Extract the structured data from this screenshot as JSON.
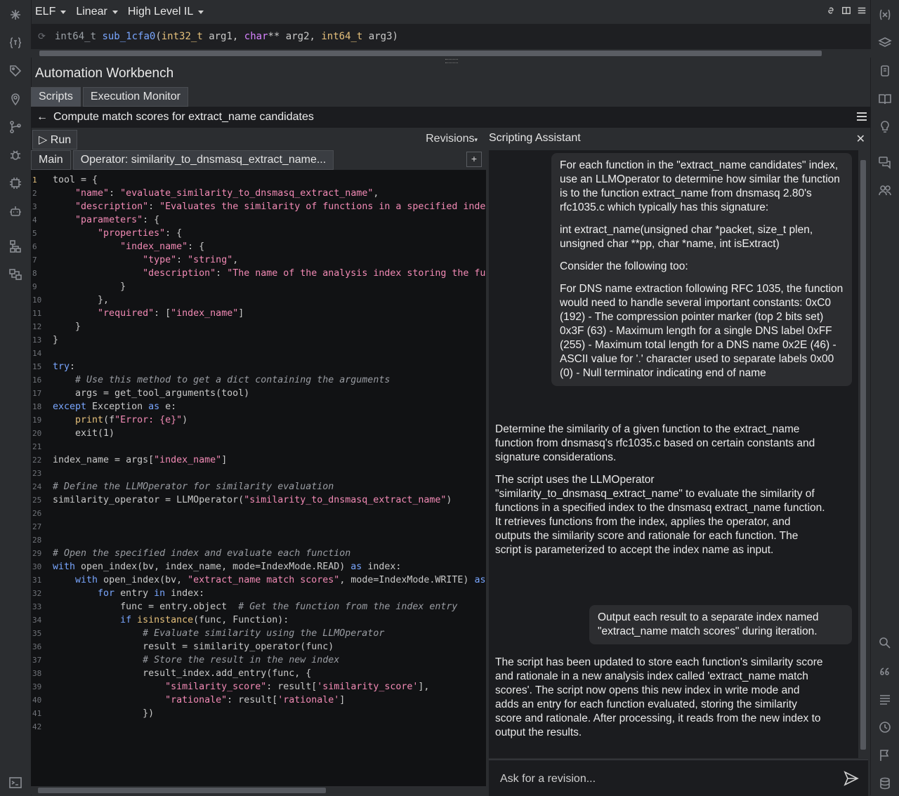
{
  "toolbar": {
    "view_type": "ELF",
    "layout": "Linear",
    "il_level": "High Level IL"
  },
  "signature": {
    "ret_type": "int64_t",
    "func_name": "sub_1cfa0",
    "open": "(",
    "p1_type": "int32_t",
    "p1_name": " arg1, ",
    "p2_type": "char",
    "p2_rest": "** arg2, ",
    "p3_type": "int64_t",
    "p3_name": " arg3",
    "close": ")"
  },
  "workbench": {
    "title": "Automation Workbench",
    "tabs": [
      "Scripts",
      "Execution Monitor"
    ],
    "breadcrumb": "Compute match scores for extract_name candidates",
    "run_label": "Run",
    "revisions_label": "Revisions",
    "subtabs": [
      "Main",
      "Operator: similarity_to_dnsmasq_extract_name..."
    ]
  },
  "assistant": {
    "title": "Scripting Assistant",
    "input_placeholder": "Ask for a revision...",
    "msg1": [
      "For each function in the \"extract_name candidates\" index, use an LLMOperator to determine how similar the function is to the function extract_name from dnsmasq 2.80's rfc1035.c which typically has this signature:",
      "int extract_name(unsigned char *packet, size_t plen, unsigned char **pp, char *name, int isExtract)",
      "Consider the following too:",
      "For DNS name extraction following RFC 1035, the function would need to handle several important constants: 0xC0 (192) - The compression pointer marker (top 2 bits set) 0x3F (63) - Maximum length for a single DNS label 0xFF (255) - Maximum total length for a DNS name 0x2E (46) - ASCII value for '.' character used to separate labels 0x00 (0) - Null terminator indicating end of name"
    ],
    "reply1": [
      "Determine the similarity of a given function to the extract_name function from dnsmasq's rfc1035.c based on certain constants and signature considerations.",
      "The script uses the LLMOperator \"similarity_to_dnsmasq_extract_name\" to evaluate the similarity of functions in a specified index to the dnsmasq extract_name function. It retrieves functions from the index, applies the operator, and outputs the similarity score and rationale for each function. The script is parameterized to accept the index name as input."
    ],
    "msg2": "Output each result to a separate index named \"extract_name match scores\" during iteration.",
    "reply2": "The script has been updated to store each function's similarity score and rationale in a new analysis index called 'extract_name match scores'. The script now opens this new index in write mode and adds an entry for each function evaluated, storing the similarity score and rationale. After processing, it reads from the new index to output the results."
  },
  "code_lines": [
    [
      [
        "p",
        "tool = {"
      ]
    ],
    [
      [
        "p",
        "    "
      ],
      [
        "s",
        "\"name\""
      ],
      [
        "p",
        ": "
      ],
      [
        "s",
        "\"evaluate_similarity_to_dnsmasq_extract_name\""
      ],
      [
        "p",
        ","
      ]
    ],
    [
      [
        "p",
        "    "
      ],
      [
        "s",
        "\"description\""
      ],
      [
        "p",
        ": "
      ],
      [
        "s",
        "\"Evaluates the similarity of functions in a specified inde"
      ]
    ],
    [
      [
        "p",
        "    "
      ],
      [
        "s",
        "\"parameters\""
      ],
      [
        "p",
        ": {"
      ]
    ],
    [
      [
        "p",
        "        "
      ],
      [
        "s",
        "\"properties\""
      ],
      [
        "p",
        ": {"
      ]
    ],
    [
      [
        "p",
        "            "
      ],
      [
        "s",
        "\"index_name\""
      ],
      [
        "p",
        ": {"
      ]
    ],
    [
      [
        "p",
        "                "
      ],
      [
        "s",
        "\"type\""
      ],
      [
        "p",
        ": "
      ],
      [
        "s",
        "\"string\""
      ],
      [
        "p",
        ","
      ]
    ],
    [
      [
        "p",
        "                "
      ],
      [
        "s",
        "\"description\""
      ],
      [
        "p",
        ": "
      ],
      [
        "s",
        "\"The name of the analysis index storing the fu"
      ]
    ],
    [
      [
        "p",
        "            }"
      ]
    ],
    [
      [
        "p",
        "        },"
      ]
    ],
    [
      [
        "p",
        "        "
      ],
      [
        "s",
        "\"required\""
      ],
      [
        "p",
        ": ["
      ],
      [
        "s",
        "\"index_name\""
      ],
      [
        "p",
        "]"
      ]
    ],
    [
      [
        "p",
        "    }"
      ]
    ],
    [
      [
        "p",
        "}"
      ]
    ],
    [],
    [
      [
        "k",
        "try"
      ],
      [
        "p",
        ":"
      ]
    ],
    [
      [
        "p",
        "    "
      ],
      [
        "c",
        "# Use this method to get a dict containing the arguments"
      ]
    ],
    [
      [
        "p",
        "    args = get_tool_arguments(tool)"
      ]
    ],
    [
      [
        "k",
        "except"
      ],
      [
        "p",
        " Exception "
      ],
      [
        "k",
        "as"
      ],
      [
        "p",
        " e:"
      ]
    ],
    [
      [
        "p",
        "    "
      ],
      [
        "f",
        "print"
      ],
      [
        "p",
        "(f"
      ],
      [
        "s",
        "\"Error: {e}\""
      ],
      [
        "p",
        ")"
      ]
    ],
    [
      [
        "p",
        "    exit(1)"
      ]
    ],
    [],
    [
      [
        "p",
        "index_name = args["
      ],
      [
        "s",
        "\"index_name\""
      ],
      [
        "p",
        "]"
      ]
    ],
    [],
    [
      [
        "c",
        "# Define the LLMOperator for similarity evaluation"
      ]
    ],
    [
      [
        "p",
        "similarity_operator = LLMOperator("
      ],
      [
        "s",
        "\"similarity_to_dnsmasq_extract_name\""
      ],
      [
        "p",
        ")"
      ]
    ],
    [],
    [],
    [],
    [
      [
        "c",
        "# Open the specified index and evaluate each function"
      ]
    ],
    [
      [
        "k",
        "with"
      ],
      [
        "p",
        " open_index(bv, index_name, mode=IndexMode.READ) "
      ],
      [
        "k",
        "as"
      ],
      [
        "p",
        " index:"
      ]
    ],
    [
      [
        "p",
        "    "
      ],
      [
        "k",
        "with"
      ],
      [
        "p",
        " open_index(bv, "
      ],
      [
        "s",
        "\"extract_name match scores\""
      ],
      [
        "p",
        ", mode=IndexMode.WRITE) "
      ],
      [
        "k",
        "as"
      ]
    ],
    [
      [
        "p",
        "        "
      ],
      [
        "k",
        "for"
      ],
      [
        "p",
        " entry "
      ],
      [
        "k",
        "in"
      ],
      [
        "p",
        " index:"
      ]
    ],
    [
      [
        "p",
        "            func = entry.object  "
      ],
      [
        "c",
        "# Get the function from the index entry"
      ]
    ],
    [
      [
        "p",
        "            "
      ],
      [
        "k",
        "if"
      ],
      [
        "p",
        " "
      ],
      [
        "f",
        "isinstance"
      ],
      [
        "p",
        "(func, Function):"
      ]
    ],
    [
      [
        "p",
        "                "
      ],
      [
        "c",
        "# Evaluate similarity using the LLMOperator"
      ]
    ],
    [
      [
        "p",
        "                result = similarity_operator(func)"
      ]
    ],
    [
      [
        "p",
        "                "
      ],
      [
        "c",
        "# Store the result in the new index"
      ]
    ],
    [
      [
        "p",
        "                result_index.add_entry(func, {"
      ]
    ],
    [
      [
        "p",
        "                    "
      ],
      [
        "s",
        "\"similarity_score\""
      ],
      [
        "p",
        ": result["
      ],
      [
        "s",
        "'similarity_score'"
      ],
      [
        "p",
        "],"
      ]
    ],
    [
      [
        "p",
        "                    "
      ],
      [
        "s",
        "\"rationale\""
      ],
      [
        "p",
        ": result["
      ],
      [
        "s",
        "'rationale'"
      ],
      [
        "p",
        "]"
      ]
    ],
    [
      [
        "p",
        "                })"
      ]
    ],
    []
  ]
}
